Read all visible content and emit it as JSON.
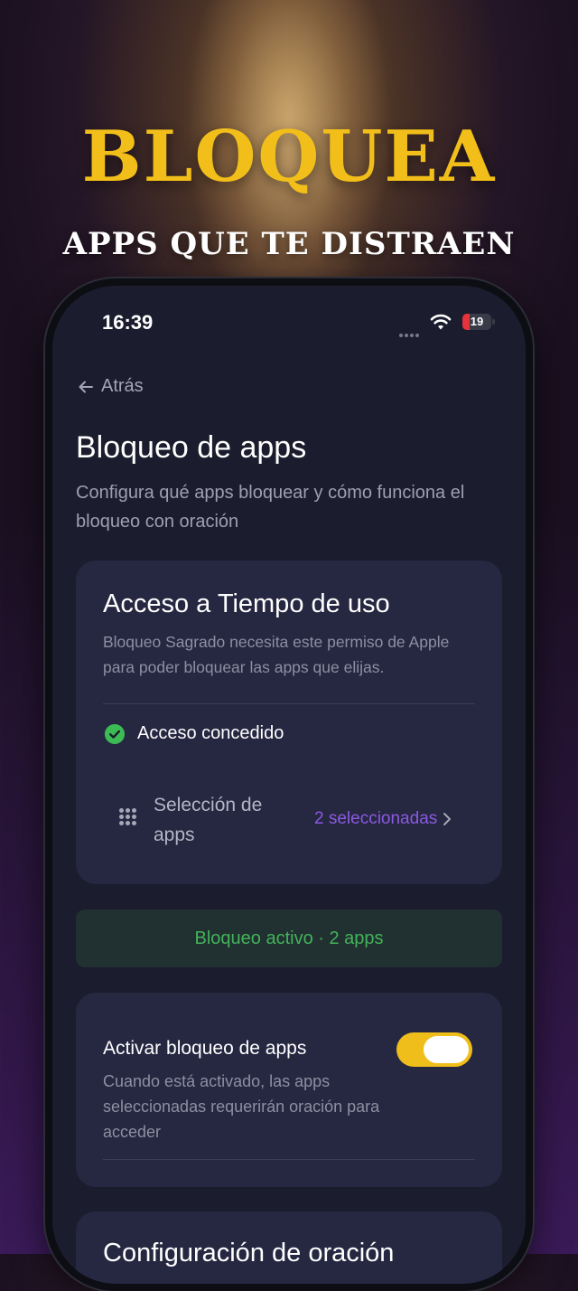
{
  "hero": {
    "title": "BLOQUEA",
    "subtitle": "APPS QUE TE DISTRAEN"
  },
  "status_bar": {
    "time": "16:39",
    "battery": "19",
    "icons": [
      "signal-dots-icon",
      "wifi-icon",
      "battery-icon"
    ]
  },
  "nav": {
    "back_label": "Atrás",
    "back_icon": "arrow-left-icon"
  },
  "page": {
    "title": "Bloqueo de apps",
    "subtitle": "Configura qué apps bloquear y cómo funciona el bloqueo con oración"
  },
  "screen_time_card": {
    "title": "Acceso a Tiempo de uso",
    "description": "Bloqueo Sagrado necesita este permiso de Apple para poder bloquear las apps que elijas.",
    "access_status": "Acceso concedido",
    "selection_label": "Selección de apps",
    "selection_value": "2 seleccionadas"
  },
  "status_banner": {
    "text": "Bloqueo activo · 2 apps"
  },
  "toggle_card": {
    "label": "Activar bloqueo de apps",
    "description": "Cuando está activado, las apps seleccionadas requerirán oración para acceder",
    "enabled": true
  },
  "prayer_card": {
    "title": "Configuración de oración"
  },
  "colors": {
    "accent_gold": "#f0be1a",
    "success_green": "#3cbb55",
    "link_purple": "#8b5ae0",
    "screen_bg": "#1b1c2d",
    "card_bg": "#262741"
  }
}
